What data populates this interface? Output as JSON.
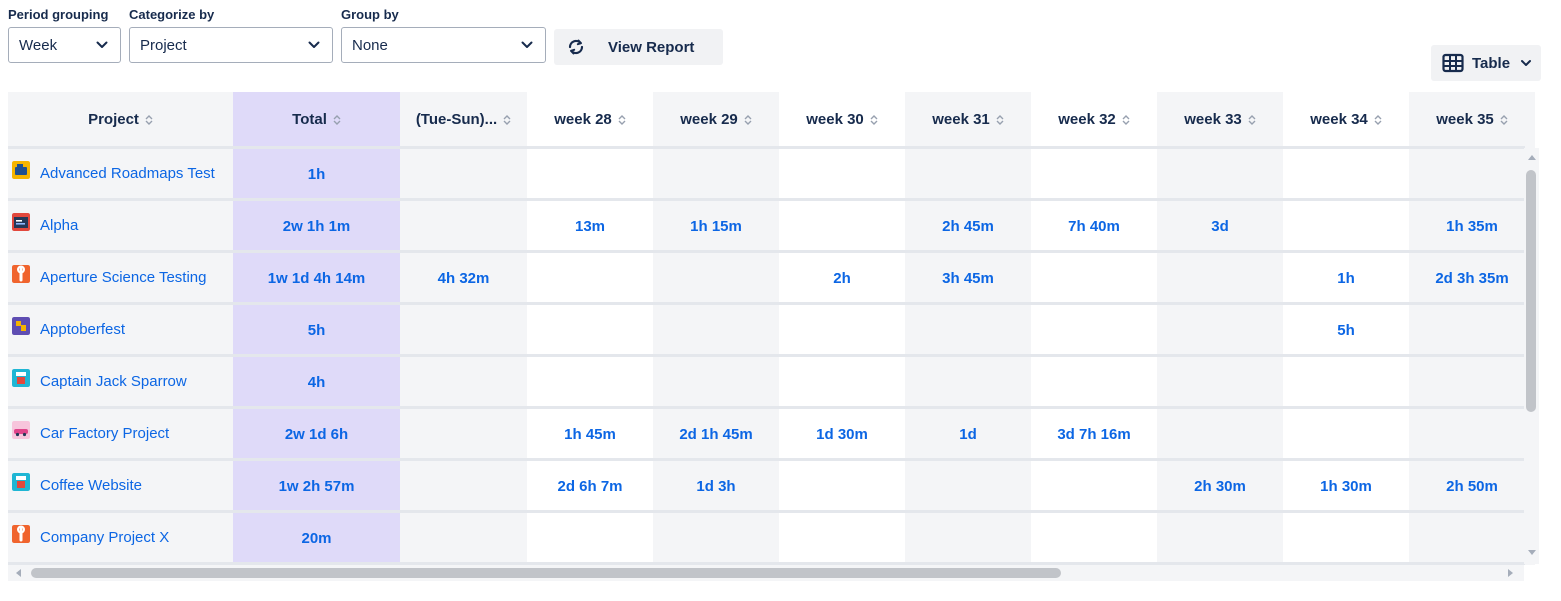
{
  "filters": {
    "period": {
      "label": "Period grouping",
      "value": "Week"
    },
    "categorize": {
      "label": "Categorize by",
      "value": "Project"
    },
    "group": {
      "label": "Group by",
      "value": "None"
    }
  },
  "view_report_label": "View Report",
  "view_toggle_label": "Table",
  "table": {
    "headers": [
      "Project",
      "Total",
      "(Tue-Sun)...",
      "week 28",
      "week 29",
      "week 30",
      "week 31",
      "week 32",
      "week 33",
      "week 34",
      "week 35"
    ],
    "rows": [
      {
        "project": "Advanced Roadmaps Test",
        "icon": "roadmap-project-icon",
        "total": "1h",
        "cells": [
          "",
          "",
          "",
          "",
          "",
          "",
          "",
          "",
          ""
        ]
      },
      {
        "project": "Alpha",
        "icon": "code-project-icon",
        "total": "2w 1h 1m",
        "cells": [
          "",
          "13m",
          "1h 15m",
          "",
          "2h 45m",
          "7h 40m",
          "3d",
          "",
          "1h 35m"
        ]
      },
      {
        "project": "Aperture Science Testing",
        "icon": "wrench-project-icon",
        "total": "1w 1d 4h 14m",
        "cells": [
          "4h 32m",
          "",
          "",
          "2h",
          "3h 45m",
          "",
          "",
          "1h",
          "2d 3h 35m"
        ]
      },
      {
        "project": "Apptoberfest",
        "icon": "puzzle-project-icon",
        "total": "5h",
        "cells": [
          "",
          "",
          "",
          "",
          "",
          "",
          "",
          "5h",
          ""
        ]
      },
      {
        "project": "Captain Jack Sparrow",
        "icon": "cup-project-icon",
        "total": "4h",
        "cells": [
          "",
          "",
          "",
          "",
          "",
          "",
          "",
          "",
          ""
        ]
      },
      {
        "project": "Car Factory Project",
        "icon": "car-project-icon",
        "total": "2w 1d 6h",
        "cells": [
          "",
          "1h 45m",
          "2d 1h 45m",
          "1d 30m",
          "1d",
          "3d 7h 16m",
          "",
          "",
          ""
        ]
      },
      {
        "project": "Coffee Website",
        "icon": "coffee-project-icon",
        "total": "1w 2h 57m",
        "cells": [
          "",
          "2d 6h 7m",
          "1d 3h",
          "",
          "",
          "",
          "2h 30m",
          "1h 30m",
          "2h 50m"
        ]
      },
      {
        "project": "Company Project X",
        "icon": "wrench-project-icon",
        "total": "20m",
        "cells": [
          "",
          "",
          "",
          "",
          "",
          "",
          "",
          "",
          ""
        ]
      }
    ]
  },
  "colors": {
    "accent": "#0c66e4",
    "total_column": "#dfdaf9",
    "alt_column": "#f4f5f7",
    "text": "#172b4d"
  }
}
